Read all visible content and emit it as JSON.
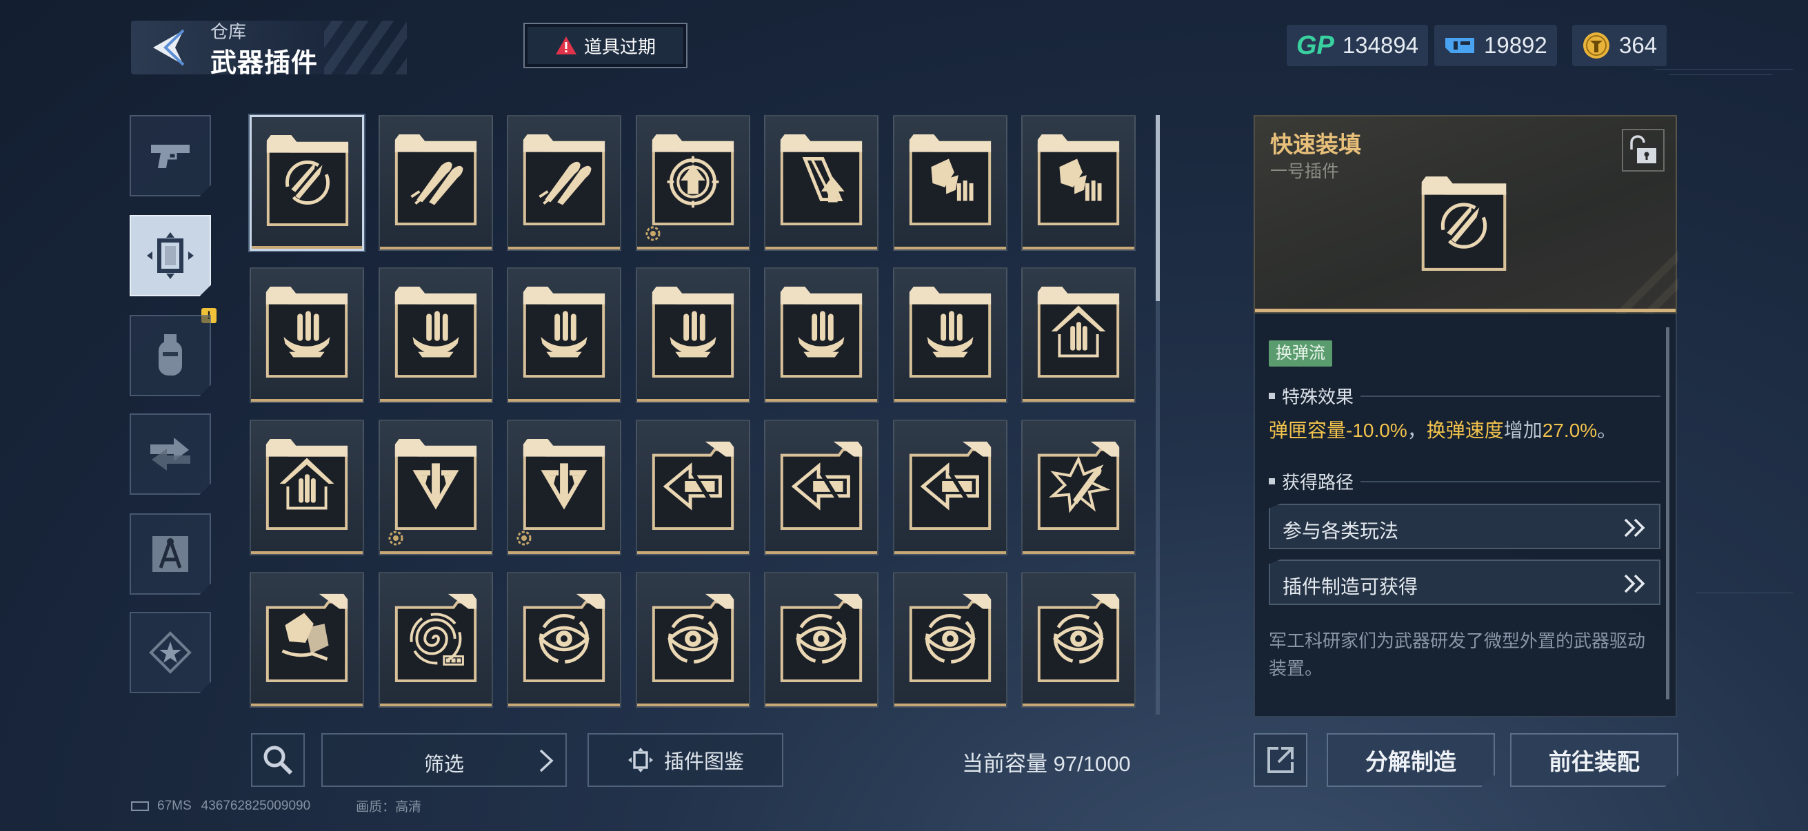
{
  "header": {
    "category": "仓库",
    "title": "武器插件",
    "alert_label": "道具过期"
  },
  "currencies": [
    {
      "name": "gp-icon",
      "label": "GP",
      "value": "134894",
      "color": "#3ad1a0"
    },
    {
      "name": "ticket-icon",
      "value": "19892",
      "color": "#4aa3f0"
    },
    {
      "name": "coin-icon",
      "value": "364",
      "color": "#e8b33a"
    }
  ],
  "side_tabs": [
    {
      "name": "tab-weapons",
      "icon": "pistol-icon",
      "active": false
    },
    {
      "name": "tab-plugins",
      "icon": "plugin-frame-icon",
      "active": true
    },
    {
      "name": "tab-grenades",
      "icon": "grenade-icon",
      "active": false,
      "badge": "!"
    },
    {
      "name": "tab-skins",
      "icon": "swap-icon",
      "active": false
    },
    {
      "name": "tab-characters",
      "icon": "compass-icon",
      "active": false
    },
    {
      "name": "tab-badges",
      "icon": "star-icon",
      "active": false
    }
  ],
  "grid": {
    "items": [
      {
        "icon": "rocket-cycle",
        "selected": true
      },
      {
        "icon": "bullets-pair"
      },
      {
        "icon": "bullets-pair"
      },
      {
        "icon": "crosshair-up",
        "gear": true
      },
      {
        "icon": "mag-up"
      },
      {
        "icon": "shards-ammo"
      },
      {
        "icon": "shards-ammo"
      },
      {
        "icon": "ammo-wing"
      },
      {
        "icon": "ammo-wing"
      },
      {
        "icon": "ammo-wing"
      },
      {
        "icon": "ammo-wing"
      },
      {
        "icon": "ammo-wing"
      },
      {
        "icon": "ammo-wing"
      },
      {
        "icon": "house-ammo"
      },
      {
        "icon": "house-ammo"
      },
      {
        "icon": "bullet-chevron",
        "gear": true
      },
      {
        "icon": "bullet-chevron",
        "gear": true
      },
      {
        "icon": "arrow-left",
        "flip": true
      },
      {
        "icon": "arrow-left",
        "flip": true
      },
      {
        "icon": "arrow-left",
        "flip": true
      },
      {
        "icon": "burst-bullet",
        "flip": true
      },
      {
        "icon": "shards-hand",
        "flip": true
      },
      {
        "icon": "spiral-battery",
        "flip": true
      },
      {
        "icon": "eye",
        "flip": true
      },
      {
        "icon": "eye",
        "flip": true
      },
      {
        "icon": "eye",
        "flip": true
      },
      {
        "icon": "eye",
        "flip": true
      },
      {
        "icon": "eye",
        "flip": true
      }
    ]
  },
  "bottom": {
    "filter_label": "筛选",
    "atlas_label": "插件图鉴",
    "capacity_label": "当前容量 97/1000"
  },
  "footer": {
    "ping": "67MS",
    "uid": "436762825009090",
    "quality": "画质：高清"
  },
  "detail": {
    "name": "快速装填",
    "slot": "一号插件",
    "tag": "换弹流",
    "effect_header": "特殊效果",
    "effect": {
      "part1": "弹匣容量",
      "part2": "-10.0%",
      "part3": "，",
      "part4": "换弹速度",
      "part5": "增加",
      "part6": "27.0%",
      "part7": "。"
    },
    "source_header": "获得路径",
    "sources": [
      "参与各类玩法",
      "插件制造可获得"
    ],
    "description": "军工科研家们为武器研发了微型外置的武器驱动装置。"
  },
  "actions": {
    "dismantle_label": "分解制造",
    "equip_label": "前往装配"
  },
  "colors": {
    "accent_gold": "#e8c07a",
    "highlight_yellow": "#f2c24c",
    "tag_green": "#5a9c6e",
    "cell_base": "#c9a877"
  }
}
